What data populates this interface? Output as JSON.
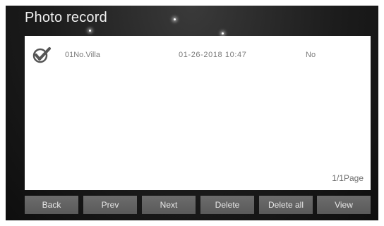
{
  "header": {
    "title": "Photo record"
  },
  "records": [
    {
      "icon": "checkmark-icon",
      "name": "01No.Villa",
      "datetime": "01-26-2018  10:47",
      "status": "No"
    }
  ],
  "pagination": {
    "label": "1/1Page"
  },
  "toolbar": {
    "back_label": "Back",
    "prev_label": "Prev",
    "next_label": "Next",
    "delete_label": "Delete",
    "delete_all_label": "Delete all",
    "view_label": "View"
  },
  "colors": {
    "background": "#1c1c1c",
    "panel": "#ffffff",
    "button": "#636363",
    "button_text": "#e8e8e8",
    "row_text": "#7a7a7a"
  }
}
